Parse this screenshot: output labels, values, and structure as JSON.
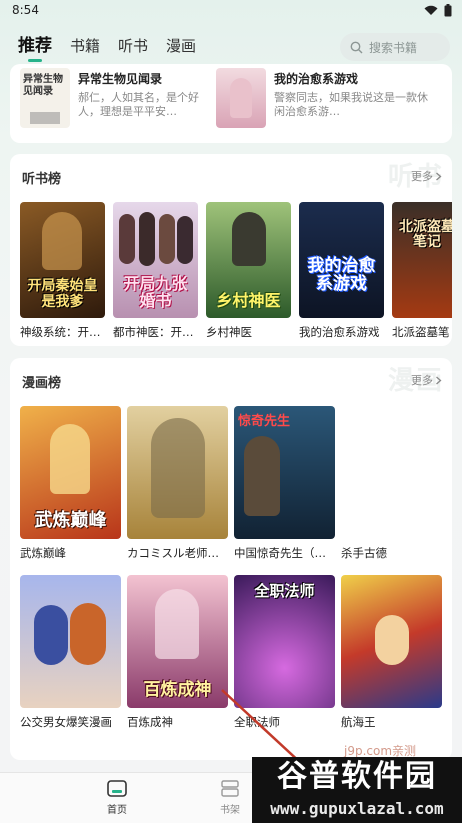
{
  "status_bar": {
    "time": "8:54"
  },
  "tabs": [
    {
      "label": "推荐",
      "active": true
    },
    {
      "label": "书籍",
      "active": false
    },
    {
      "label": "听书",
      "active": false
    },
    {
      "label": "漫画",
      "active": false
    }
  ],
  "search": {
    "placeholder": "搜索书籍"
  },
  "top_books": [
    {
      "title": "异常生物见闻录",
      "desc": "郝仁，人如其名，是个好人，理想是平平安…",
      "cover_text": "异常生物见闻录"
    },
    {
      "title": "我的治愈系游戏",
      "desc": "警察同志，如果我说这是一款休闲治愈系游…",
      "cover_text": ""
    }
  ],
  "audio_section": {
    "title": "听书榜",
    "more": "更多",
    "watermark": "听书",
    "items": [
      {
        "title": "神级系统：开…",
        "cover_text": "开局秦始皇是我爹",
        "color": "#5b3a1e"
      },
      {
        "title": "都市神医：开…",
        "cover_text": "开局九张婚书",
        "color": "#c9a3b8"
      },
      {
        "title": "乡村神医",
        "cover_text": "乡村神医",
        "color": "#3f7a3a"
      },
      {
        "title": "我的治愈系游戏",
        "cover_text": "我的治愈系游戏",
        "color": "#1c2b4a"
      },
      {
        "title": "北派盗墓笔",
        "cover_text": "北派盗墓笔记",
        "color": "#2e2a24"
      }
    ]
  },
  "comic_section": {
    "title": "漫画榜",
    "more": "更多",
    "watermark": "漫画",
    "items": [
      {
        "title": "武炼巅峰",
        "cover_text": "武炼巅峰",
        "color": "#d9632a"
      },
      {
        "title": "カコミスル老师…",
        "cover_text": "",
        "color": "#c8a34a"
      },
      {
        "title": "中国惊奇先生（…",
        "cover_text": "惊奇先生",
        "color": "#2a4d68"
      },
      {
        "title": "杀手古德",
        "cover_text": "",
        "color": ""
      },
      {
        "title": "公交男女爆笑漫画",
        "cover_text": "",
        "color": "#8a9bd6"
      },
      {
        "title": "百炼成神",
        "cover_text": "百炼成神",
        "color": "#d86a8a"
      },
      {
        "title": "全职法师",
        "cover_text": "全职法师",
        "color": "#5a2c8a"
      },
      {
        "title": "航海王",
        "cover_text": "",
        "color": "#d34a3a"
      }
    ]
  },
  "bottom_nav": [
    {
      "label": "首页",
      "active": true
    },
    {
      "label": "书架",
      "active": false
    }
  ],
  "watermarks": {
    "small": "j9p.com亲测",
    "logo": "谷普软件园",
    "url": "www.gupuxlazal.com"
  }
}
